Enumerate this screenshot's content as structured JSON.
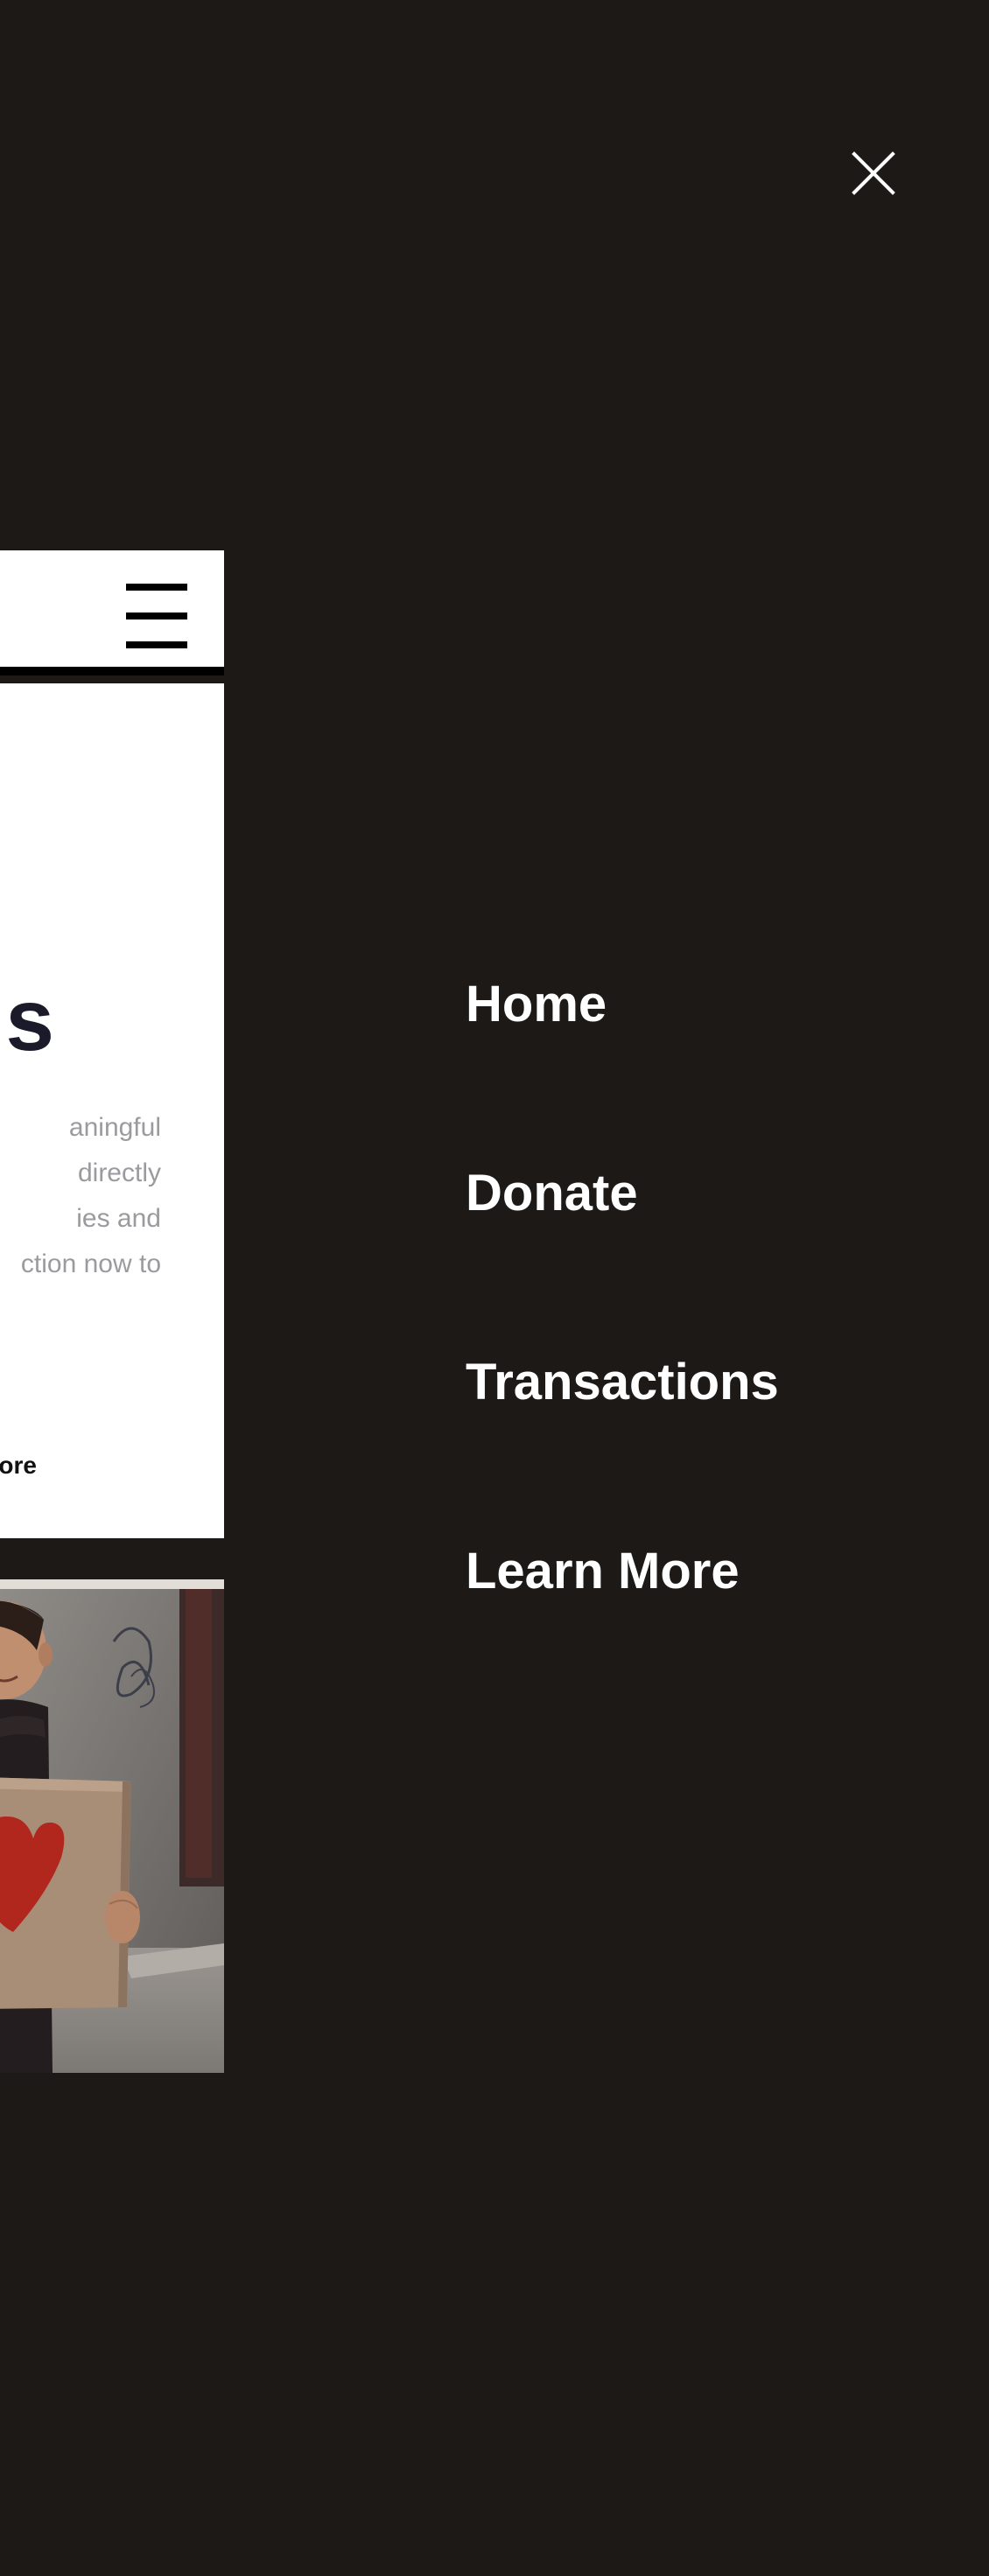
{
  "menu": {
    "items": [
      {
        "label": "Home"
      },
      {
        "label": "Donate"
      },
      {
        "label": "Transactions"
      },
      {
        "label": "Learn More"
      }
    ],
    "close_icon": "close-icon"
  },
  "background_page": {
    "hero_title": "s",
    "hero_desc_lines": [
      "aningful",
      " directly",
      "ies and",
      "ction now to"
    ],
    "learn_more_label": "ore",
    "menu_icon": "hamburger-menu-icon"
  },
  "colors": {
    "overlay_bg": "#1d1917",
    "menu_text": "#ffffff",
    "hero_title": "#1a1a2a",
    "hero_desc": "#9a9a9f"
  }
}
